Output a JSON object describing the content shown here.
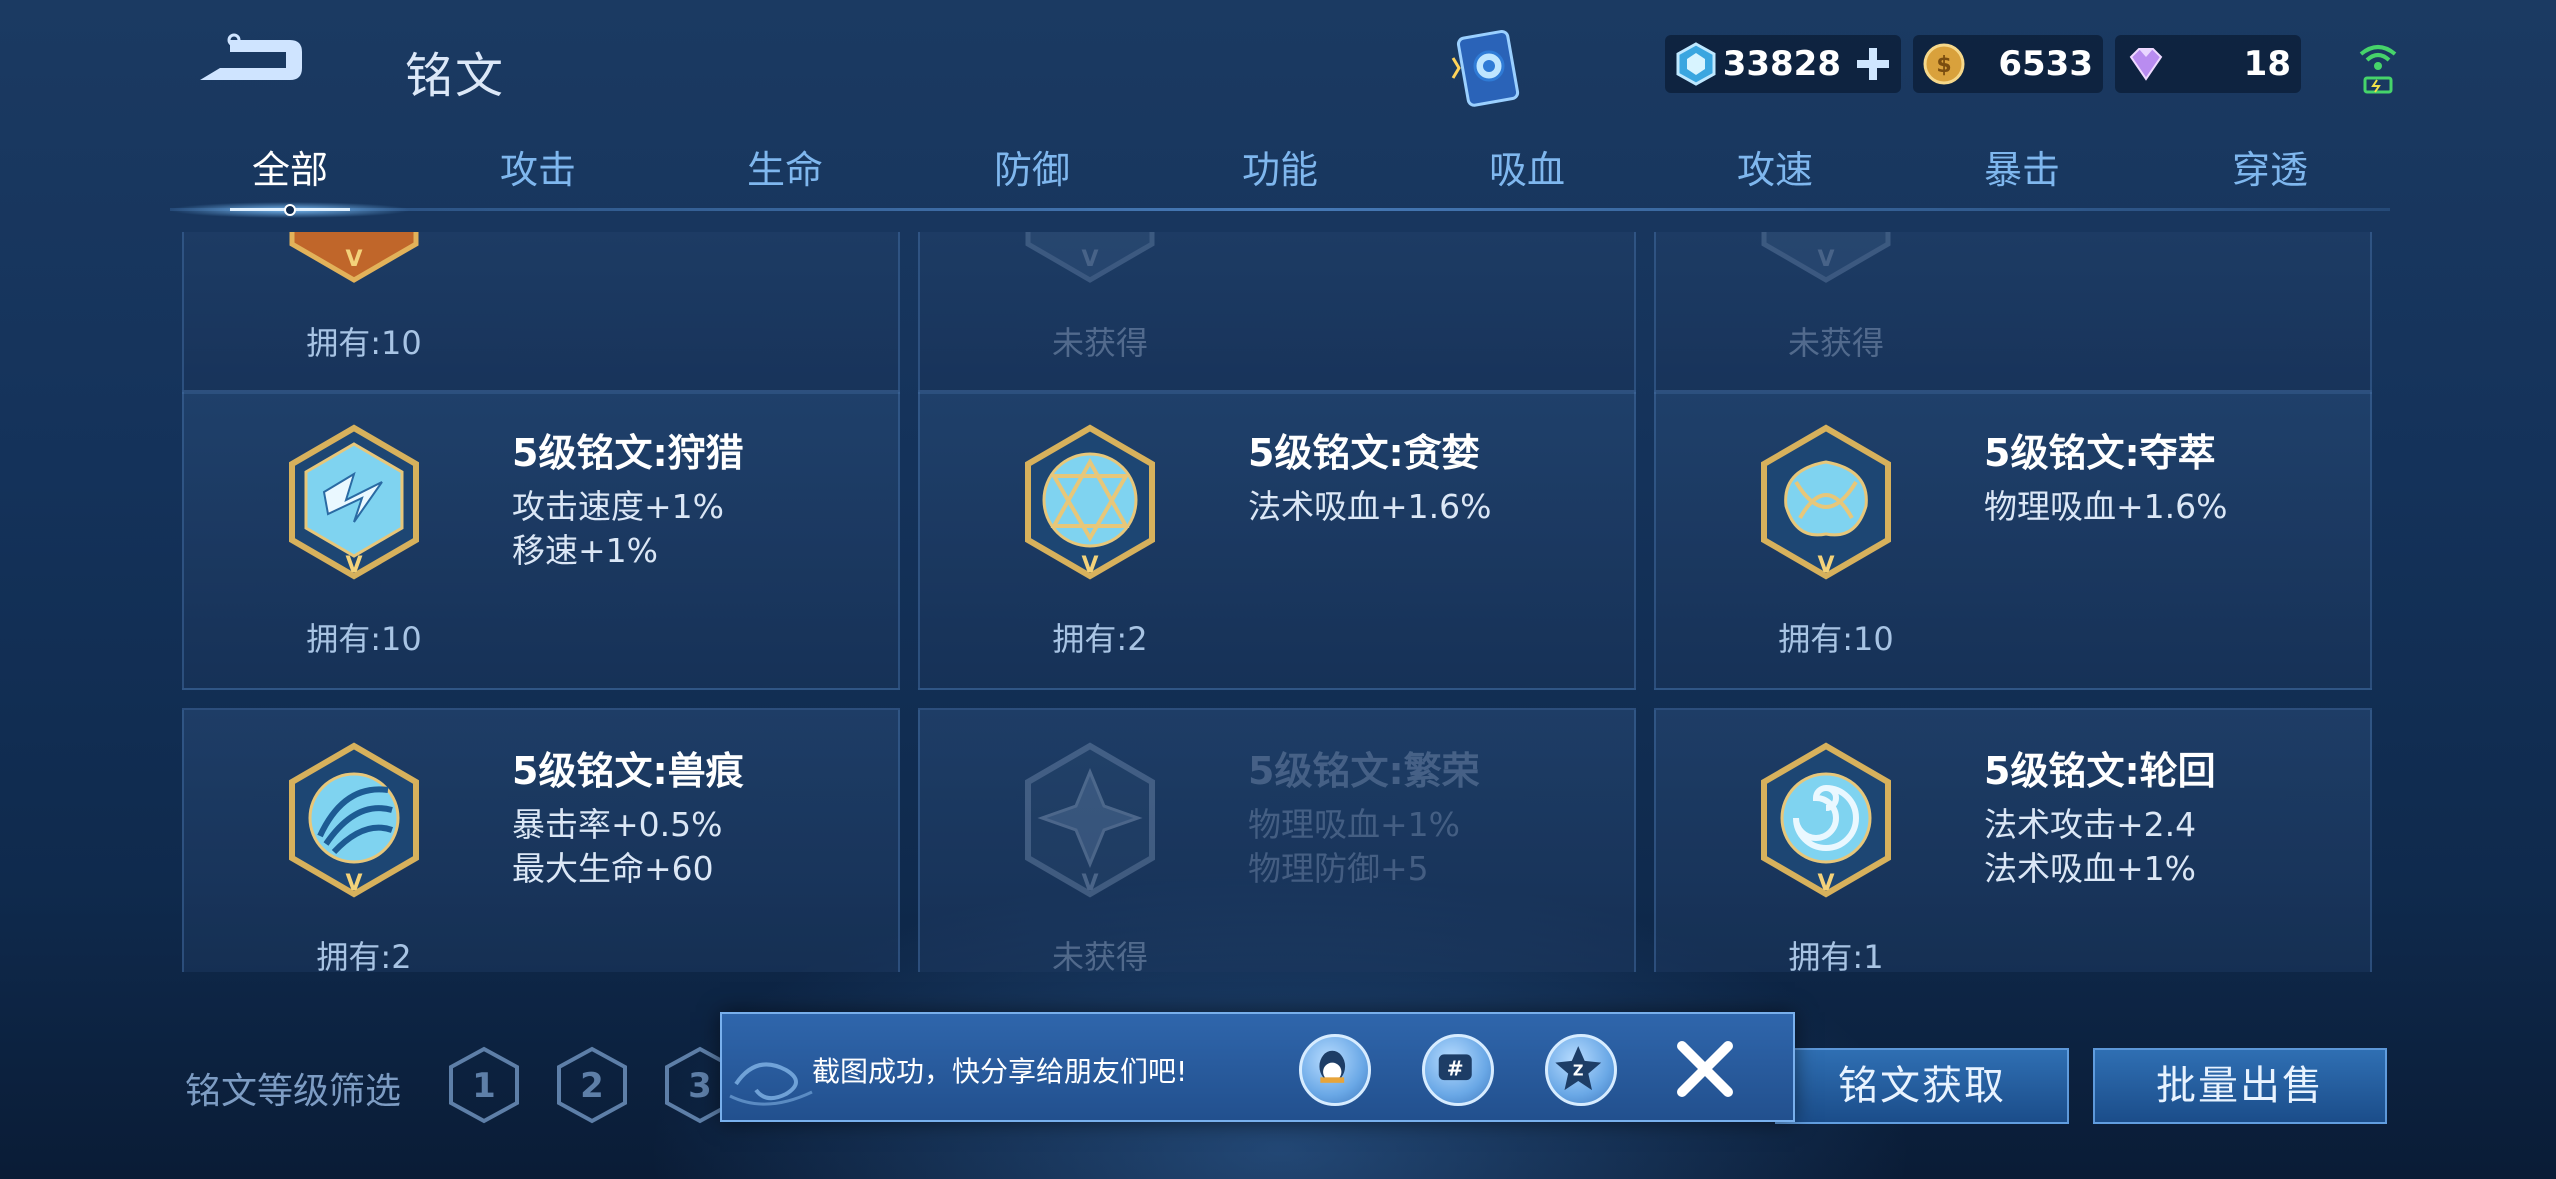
{
  "header": {
    "title": "铭文",
    "currencies": [
      {
        "name": "inscription-fragments",
        "value": "33828"
      },
      {
        "name": "gold",
        "value": "6533"
      },
      {
        "name": "diamonds",
        "value": "18"
      }
    ]
  },
  "tabs": [
    "全部",
    "攻击",
    "生命",
    "防御",
    "功能",
    "吸血",
    "攻速",
    "暴击",
    "穿透"
  ],
  "active_tab": "全部",
  "partial_row": [
    {
      "own": "拥有:10",
      "locked": false
    },
    {
      "own": "未获得",
      "locked": true
    },
    {
      "own": "未获得",
      "locked": true
    }
  ],
  "inscriptions": [
    {
      "name": "5级铭文:狩猎",
      "attrs": [
        "攻击速度+1%",
        "移速+1%"
      ],
      "own": "拥有:10",
      "locked": false,
      "icon": "hunt-emblem-icon"
    },
    {
      "name": "5级铭文:贪婪",
      "attrs": [
        "法术吸血+1.6%"
      ],
      "own": "拥有:2",
      "locked": false,
      "icon": "greed-emblem-icon"
    },
    {
      "name": "5级铭文:夺萃",
      "attrs": [
        "物理吸血+1.6%"
      ],
      "own": "拥有:10",
      "locked": false,
      "icon": "seize-emblem-icon"
    },
    {
      "name": "5级铭文:兽痕",
      "attrs": [
        "暴击率+0.5%",
        "最大生命+60"
      ],
      "own": "拥有:2",
      "locked": false,
      "icon": "beast-mark-emblem-icon"
    },
    {
      "name": "5级铭文:繁荣",
      "attrs": [
        "物理吸血+1%",
        "物理防御+5"
      ],
      "own": "未获得",
      "locked": true,
      "icon": "prosperity-emblem-icon"
    },
    {
      "name": "5级铭文:轮回",
      "attrs": [
        "法术攻击+2.4",
        "法术吸血+1%"
      ],
      "own": "拥有:1",
      "locked": false,
      "icon": "reincarnation-emblem-icon"
    }
  ],
  "bottom": {
    "filter_label": "铭文等级筛选",
    "levels": [
      "1",
      "2",
      "3"
    ],
    "obtain_button": "铭文获取",
    "bulk_sell_button": "批量出售"
  },
  "toast": {
    "message": "截图成功，快分享给朋友们吧!",
    "share_targets": [
      "qq-icon",
      "wechat-moments-icon",
      "qzone-icon"
    ]
  },
  "colors": {
    "background": "#14325a",
    "accent": "#7fb7ee",
    "gold_frame": "#d7b15c",
    "emblem_fill": "#7fd3f0"
  }
}
